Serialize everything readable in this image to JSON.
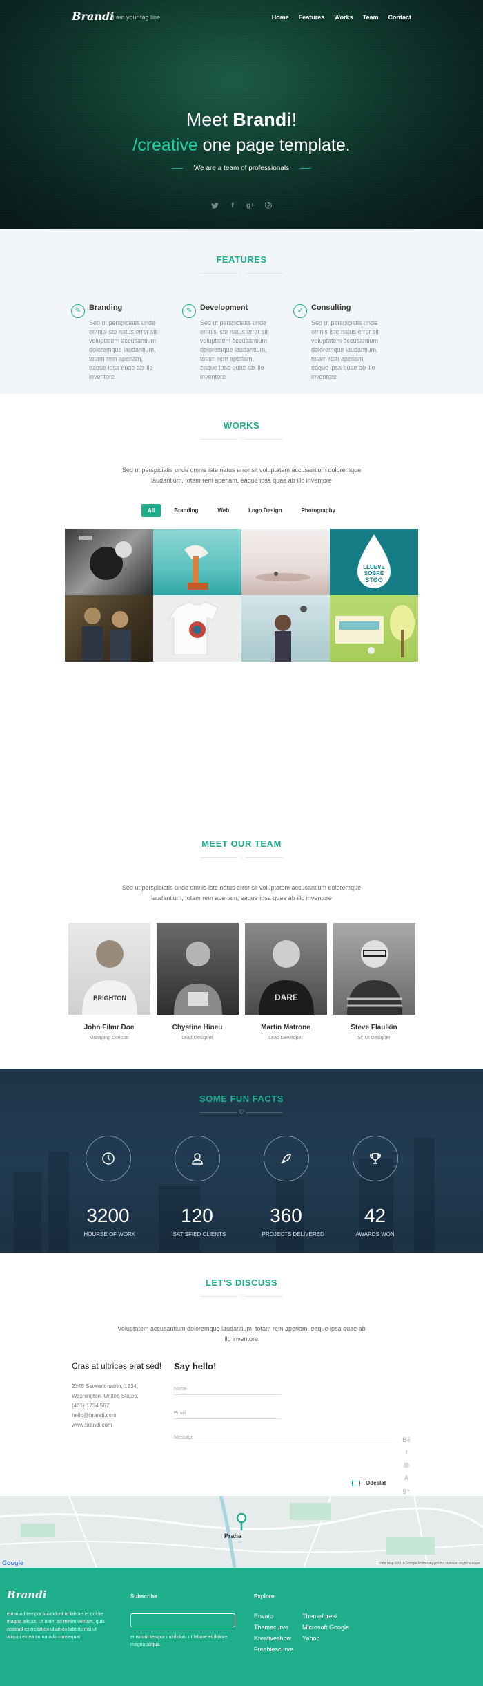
{
  "header": {
    "logo": "Brandi",
    "tagline": "I am your tag line",
    "nav": [
      "Home",
      "Features",
      "Works",
      "Team",
      "Contact"
    ]
  },
  "hero": {
    "line1_pre": "Meet ",
    "line1_bold": "Brandi",
    "line1_post": "!",
    "line2_accent": "/creative",
    "line2_rest": " one page template.",
    "subtitle": "We are a team of professionals",
    "social": [
      "twitter-icon",
      "facebook-icon",
      "google-plus-icon",
      "pinterest-icon"
    ]
  },
  "features": {
    "title": "FEATURES",
    "items": [
      {
        "title": "Branding",
        "text": "Sed ut perspiciatis unde omnis iste natus error sit voluptatem accusantium doloremque laudantium, totam rem aperiam, eaque ipsa quae ab illo inventore"
      },
      {
        "title": "Development",
        "text": "Sed ut perspiciatis unde omnis iste natus error sit voluptatem accusantium doloremque laudantium, totam rem aperiam, eaque ipsa quae ab illo inventore"
      },
      {
        "title": "Consulting",
        "text": "Sed ut perspiciatis unde omnis iste natus error sit voluptatem accusantium doloremque laudantium, totam rem aperiam, eaque ipsa quae ab illo inventore"
      }
    ]
  },
  "works": {
    "title": "WORKS",
    "intro": "Sed ut perspiciatis unde omnis iste natus error sit voluptatem accusantium doloremque laudantium, totam rem aperiam, eaque ipsa quae ab illo inventore",
    "filters": [
      "All",
      "Branding",
      "Web",
      "Logo Design",
      "Photography"
    ],
    "active_filter": "All",
    "poster_text": "LLUEVE SOBRE STGO"
  },
  "team": {
    "title": "MEET OUR TEAM",
    "intro": "Sed ut perspiciatis unde omnis iste natus error sit voluptatem accusantium doloremque laudantium, totam rem aperiam, eaque ipsa quae ab illo inventore",
    "members": [
      {
        "name": "John Filmr Doe",
        "role": "Managing Director"
      },
      {
        "name": "Chystine Hineu",
        "role": "Lead Designer"
      },
      {
        "name": "Martin Matrone",
        "role": "Lead Developer"
      },
      {
        "name": "Steve Flaulkin",
        "role": "Sr. UI Designer"
      }
    ]
  },
  "facts": {
    "title": "SOME FUN FACTS",
    "items": [
      {
        "number": "3200",
        "label": "HOURSE OF WORK",
        "icon": "clock-icon"
      },
      {
        "number": "120",
        "label": "SATISFIED CLIENTS",
        "icon": "user-icon"
      },
      {
        "number": "360",
        "label": "PROJECTS DELIVERED",
        "icon": "rocket-icon"
      },
      {
        "number": "42",
        "label": "AWARDS WON",
        "icon": "trophy-icon"
      }
    ]
  },
  "discuss": {
    "title": "LET'S DISCUSS",
    "intro": "Voluptatem accusantium doloremque laudantium, totam rem aperiam, eaque ipsa quae ab illo inventore.",
    "left_heading": "Cras at ultrices erat sed!",
    "address_lines": [
      "2345 Setwant natrer, 1234,",
      "Washington. United States.",
      "(401) 1234 567",
      "hello@brandi.com",
      "www.brandi.com"
    ],
    "form_heading": "Say hello!",
    "name_placeholder": "Name",
    "email_placeholder": "Email",
    "message_placeholder": "Message",
    "send_label": "Odeslat",
    "side_social": [
      "behance-icon",
      "twitter-icon",
      "dribbble-icon",
      "envato-icon",
      "google-plus-icon"
    ]
  },
  "map": {
    "city": "Praha",
    "provider": "Google",
    "attribution": "Data Map ©2016 Google    Podmínky použití    Nahlásit chybu v mapě"
  },
  "footer": {
    "logo": "Brandi",
    "about": "eiusmod tempor incididunt ut labore et dolore magna aliqua. Ut enim ad minim veniam, quis nostrud exercitation ullamco laboris nisi ut aliquip ex ea commodo consequat.",
    "subscribe_title": "Subscribe",
    "subscribe_text": "eiusmod tempor incididunt ut labore et dolore magna aliqua.",
    "explore_title": "Explore",
    "links_col1": [
      "Envato",
      "Themecurve",
      "Kreativeshow",
      "Freebiescurve"
    ],
    "links_col2": [
      "Themeforest",
      "Microsoft Google",
      "Yahoo"
    ]
  },
  "colors": {
    "accent": "#1fae8c",
    "hero_bg": "#0f3a2e",
    "facts_bg": "#213b52",
    "footer_bg": "#1fae8c"
  }
}
